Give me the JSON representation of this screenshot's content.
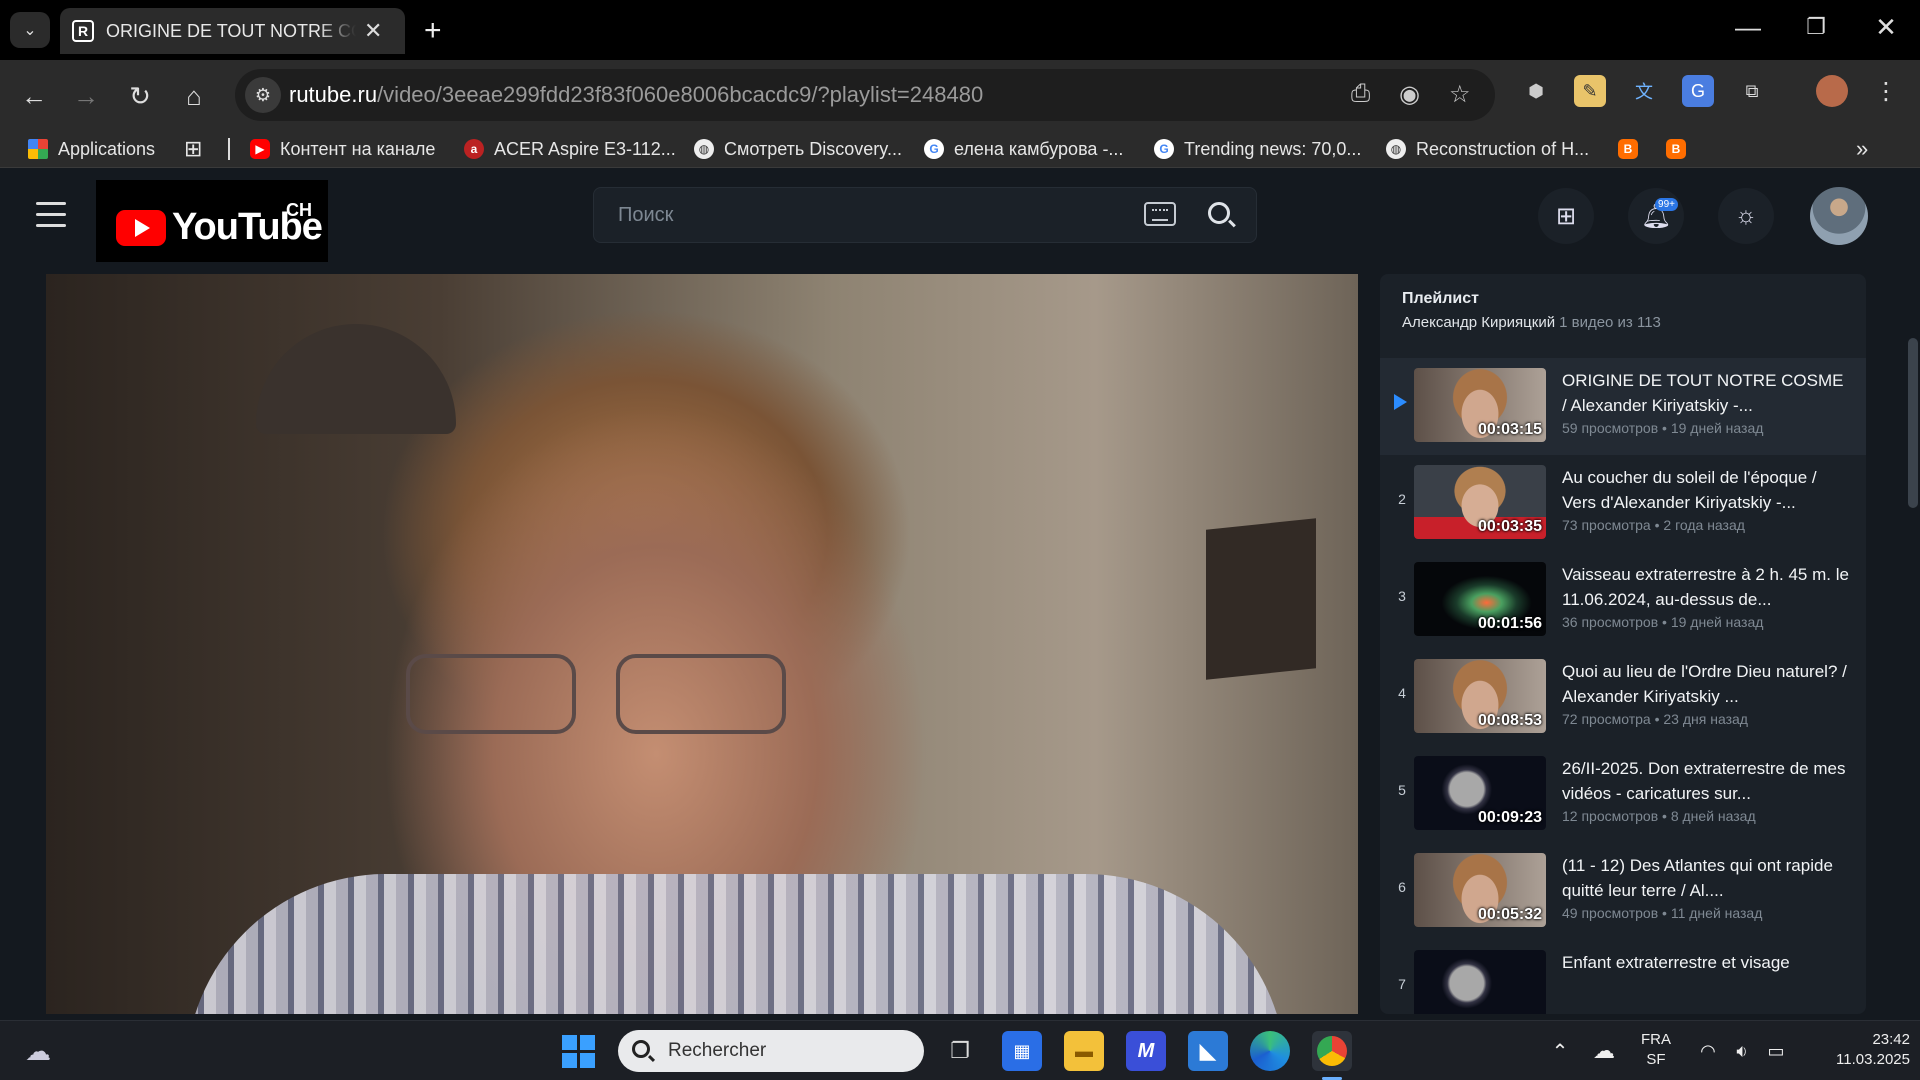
{
  "browser": {
    "tab": {
      "favicon": "R",
      "title": "ORIGINE DE TOUT NOTRE COSME"
    },
    "url_host": "rutube.ru",
    "url_path": "/video/3eeae299fdd23f83f060e8006bcacdc9/?playlist=248480",
    "bookmarks": [
      {
        "label": "Applications",
        "icon": "apps-grid-icon"
      },
      {
        "label": "Контент на канале",
        "icon": "youtube-icon"
      },
      {
        "label": "ACER Aspire E3-112...",
        "icon": "acer-icon"
      },
      {
        "label": "Смотреть Discovery...",
        "icon": "globe-icon"
      },
      {
        "label": "елена камбурова -...",
        "icon": "google-icon"
      },
      {
        "label": "Trending news: 70,0...",
        "icon": "google-icon"
      },
      {
        "label": "Reconstruction of H...",
        "icon": "globe-icon"
      }
    ]
  },
  "header": {
    "logo_text": "YouTube",
    "logo_badge": "CH",
    "search_placeholder": "Поиск",
    "notifications_badge": "99+"
  },
  "playlist": {
    "title": "Плейлист",
    "author": "Александр Кирияцкий",
    "position": "1 видео из 113",
    "items": [
      {
        "index": "1",
        "title": "ORIGINE DE TOUT NOTRE COSME / Alexander Kiriyatskiy -...",
        "duration": "00:03:15",
        "views": "59 просмотров",
        "age": "19 дней назад",
        "active": true,
        "thumb": "face"
      },
      {
        "index": "2",
        "title": "Au coucher du soleil de l'époque / Vers d'Alexander Kiriyatskiy -...",
        "duration": "00:03:35",
        "views": "73 просмотра",
        "age": "2 года назад",
        "active": false,
        "thumb": "face-red"
      },
      {
        "index": "3",
        "title": "Vaisseau extraterrestre à 2 h. 45 m. le 11.06.2024, au-dessus de...",
        "duration": "00:01:56",
        "views": "36 просмотров",
        "age": "19 дней назад",
        "active": false,
        "thumb": "space"
      },
      {
        "index": "4",
        "title": "Quoi au lieu de l'Ordre Dieu naturel? / Alexander Kiriyatskiy ...",
        "duration": "00:08:53",
        "views": "72 просмотра",
        "age": "23 дня назад",
        "active": false,
        "thumb": "face"
      },
      {
        "index": "5",
        "title": "26/II-2025. Don extraterrestre de mes vidéos - caricatures sur...",
        "duration": "00:09:23",
        "views": "12 просмотров",
        "age": "8 дней назад",
        "active": false,
        "thumb": "space2"
      },
      {
        "index": "6",
        "title": "(11 - 12) Des Atlantes qui ont rapide quitté leur terre / Al....",
        "duration": "00:05:32",
        "views": "49 просмотров",
        "age": "11 дней назад",
        "active": false,
        "thumb": "face"
      },
      {
        "index": "7",
        "title": "Enfant extraterrestre et visage",
        "duration": "",
        "views": "",
        "age": "",
        "active": false,
        "thumb": "space2"
      }
    ]
  },
  "taskbar": {
    "search_placeholder": "Rechercher",
    "lang_top": "FRA",
    "lang_bottom": "SF",
    "time": "23:42",
    "date": "11.03.2025"
  }
}
